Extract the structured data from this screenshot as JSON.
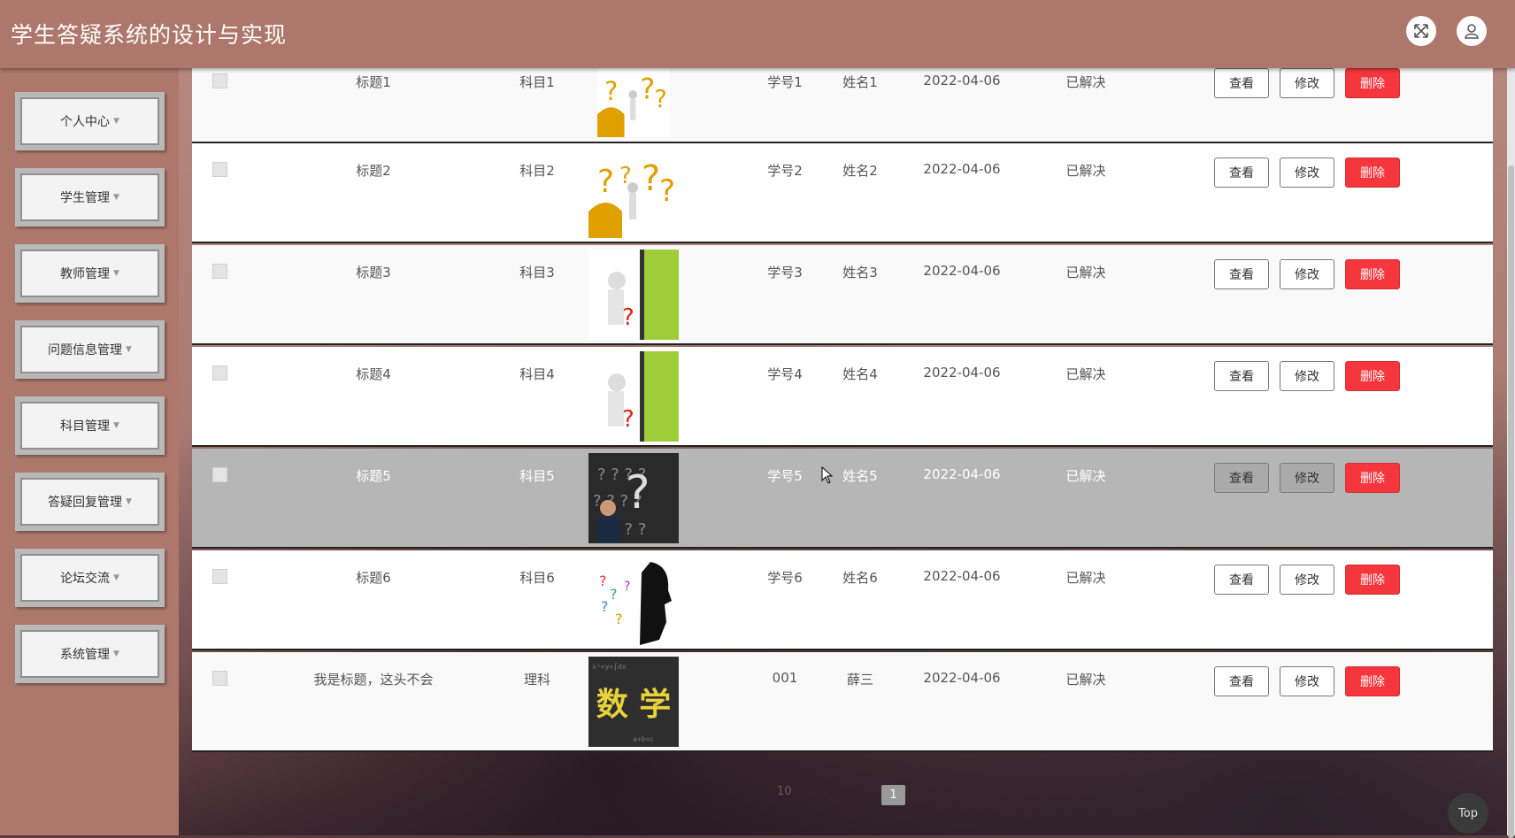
{
  "app": {
    "title": "学生答疑系统的设计与实现"
  },
  "sidebar": {
    "items": [
      {
        "label": "个人中心"
      },
      {
        "label": "学生管理"
      },
      {
        "label": "教师管理"
      },
      {
        "label": "问题信息管理"
      },
      {
        "label": "科目管理"
      },
      {
        "label": "答疑回复管理"
      },
      {
        "label": "论坛交流"
      },
      {
        "label": "系统管理"
      }
    ]
  },
  "table": {
    "actions": {
      "view": "查看",
      "edit": "修改",
      "delete": "删除"
    },
    "rows": [
      {
        "title": "标题1",
        "subject": "科目1",
        "student_id": "学号1",
        "name": "姓名1",
        "date": "2022-04-06",
        "status": "已解决",
        "image": "question-marks-figure"
      },
      {
        "title": "标题2",
        "subject": "科目2",
        "student_id": "学号2",
        "name": "姓名2",
        "date": "2022-04-06",
        "status": "已解决",
        "image": "question-marks-figure"
      },
      {
        "title": "标题3",
        "subject": "科目3",
        "student_id": "学号3",
        "name": "姓名3",
        "date": "2022-04-06",
        "status": "已解决",
        "image": "magnifier-figure-green-door"
      },
      {
        "title": "标题4",
        "subject": "科目4",
        "student_id": "学号4",
        "name": "姓名4",
        "date": "2022-04-06",
        "status": "已解决",
        "image": "magnifier-figure-green-door"
      },
      {
        "title": "标题5",
        "subject": "科目5",
        "student_id": "学号5",
        "name": "姓名5",
        "date": "2022-04-06",
        "status": "已解决",
        "image": "man-chalkboard-question"
      },
      {
        "title": "标题6",
        "subject": "科目6",
        "student_id": "学号6",
        "name": "姓名6",
        "date": "2022-04-06",
        "status": "已解决",
        "image": "head-silhouette-question"
      },
      {
        "title": "我是标题，这头不会",
        "subject": "理科",
        "student_id": "001",
        "name": "薛三",
        "date": "2022-04-06",
        "status": "已解决",
        "image": "math-chalkboard",
        "image_text": "数 学"
      }
    ]
  },
  "pager": {
    "page_size": "10",
    "current_page": "1"
  },
  "top_button": {
    "label": "Top"
  }
}
